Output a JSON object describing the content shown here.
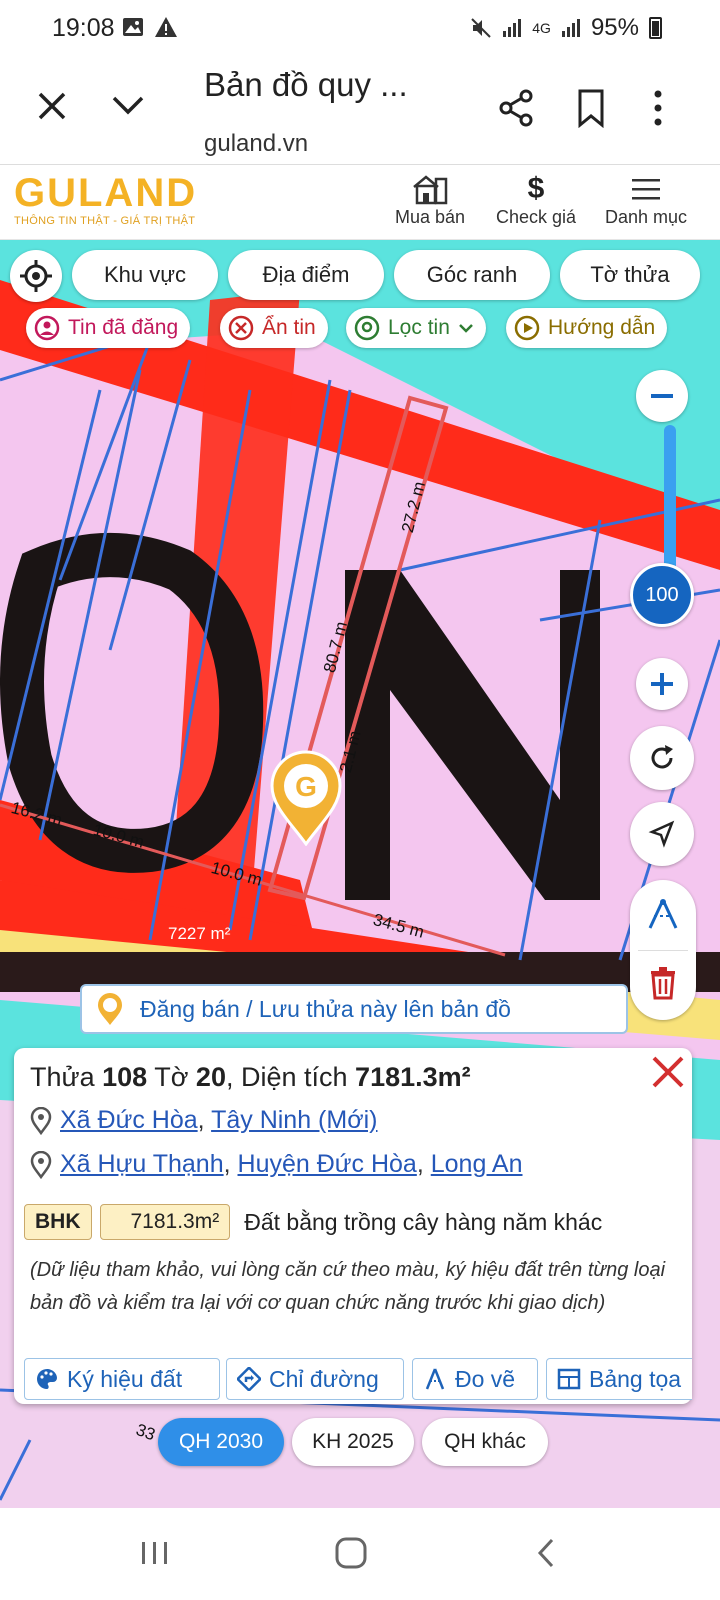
{
  "status": {
    "time": "19:08",
    "network": "4G",
    "battery": "95%"
  },
  "browser": {
    "title": "Bản đồ quy ...",
    "url": "guland.vn"
  },
  "site": {
    "logo": "GULAND",
    "tagline": "THÔNG TIN THẬT - GIÁ TRỊ THẬT",
    "nav": [
      {
        "label": "Mua bán",
        "icon": "house-icon"
      },
      {
        "label": "Check giá",
        "icon": "dollar-icon"
      },
      {
        "label": "Danh mục",
        "icon": "menu-icon"
      }
    ]
  },
  "filters": {
    "chips": [
      "Khu vực",
      "Địa điểm",
      "Góc ranh",
      "Tờ thửa"
    ]
  },
  "quick": {
    "posted": "Tin đã đăng",
    "hide": "Ẩn tin",
    "filter": "Lọc tin",
    "guide": "Hướng dẫn"
  },
  "zoom": {
    "value": "100",
    "level": 0.75
  },
  "measurements": {
    "m1": "27.2 m",
    "m2": "80.7 m",
    "m3": "2.1 m",
    "m4": "16.2 m",
    "m5": "10.0 m",
    "m6": "10.0 m",
    "m7": "34.5 m",
    "area": "7227 m²"
  },
  "map_text": {
    "partial": "33"
  },
  "banner": {
    "text": "Đăng bán / Lưu thửa này lên bản đồ"
  },
  "parcel": {
    "title_prefix": "Thửa",
    "parcel_no": "108",
    "sheet_prefix": "Tờ",
    "sheet_no": "20",
    "area_prefix": ", Diện tích",
    "area": "7181.3m²",
    "addr_new": {
      "commune": "Xã Đức Hòa",
      "province": "Tây Ninh (Mới)"
    },
    "addr_old": {
      "commune": "Xã Hựu Thạnh",
      "district": "Huyện Đức Hòa",
      "province": "Long An"
    },
    "land_code": "BHK",
    "land_area": "7181.3m²",
    "land_type": "Đất bằng trồng cây hàng năm khác",
    "note": "(Dữ liệu tham khảo, vui lòng căn cứ theo màu, ký hiệu đất trên từng loại bản đồ và kiểm tra lại với cơ quan chức năng trước khi giao dịch)"
  },
  "actions": {
    "legend": "Ký hiệu đất",
    "directions": "Chỉ đường",
    "measure": "Đo vẽ",
    "table": "Bảng tọa"
  },
  "plans": {
    "p1": "QH 2030",
    "p2": "KH 2025",
    "p3": "QH khác"
  }
}
